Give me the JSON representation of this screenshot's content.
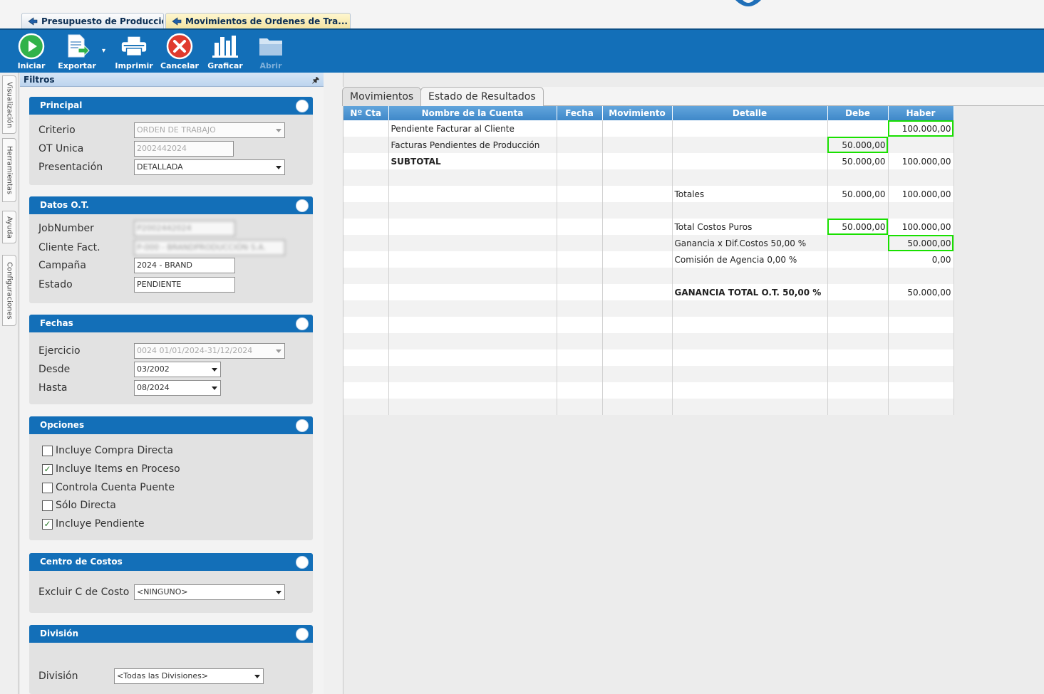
{
  "doc_tabs": [
    {
      "label": "Presupuesto de Producción",
      "active": false
    },
    {
      "label": "Movimientos de Ordenes de Tra...",
      "active": true
    }
  ],
  "toolbar": {
    "iniciar": "Iniciar",
    "exportar": "Exportar",
    "imprimir": "Imprimir",
    "cancelar": "Cancelar",
    "graficar": "Graficar",
    "abrir": "Abrir"
  },
  "side_tabs": [
    "Visualización",
    "Herramientas",
    "Ayuda",
    "Configuraciones"
  ],
  "filters": {
    "title": "Filtros",
    "pin": "🖈",
    "principal": {
      "title": "Principal",
      "criterio_label": "Criterio",
      "criterio_value": "ORDEN DE TRABAJO",
      "ot_unica_label": "OT Unica",
      "ot_unica_value": "2002442024",
      "presentacion_label": "Presentación",
      "presentacion_value": "DETALLADA"
    },
    "datos_ot": {
      "title": "Datos O.T.",
      "jobnumber_label": "JobNumber",
      "jobnumber_value": "P2002442024",
      "cliente_label": "Cliente Fact.",
      "cliente_value": "P-000 - BRANDPRODUCCIÓN S.A.",
      "campana_label": "Campaña",
      "campana_value": "2024 - BRAND",
      "estado_label": "Estado",
      "estado_value": "PENDIENTE"
    },
    "fechas": {
      "title": "Fechas",
      "ejercicio_label": "Ejercicio",
      "ejercicio_value": "0024 01/01/2024-31/12/2024",
      "desde_label": "Desde",
      "desde_value": "03/2002",
      "hasta_label": "Hasta",
      "hasta_value": "08/2024"
    },
    "opciones": {
      "title": "Opciones",
      "items": [
        {
          "label": "Incluye Compra Directa",
          "checked": false
        },
        {
          "label": "Incluye Items en Proceso",
          "checked": true
        },
        {
          "label": "Controla Cuenta Puente",
          "checked": false
        },
        {
          "label": "Sólo Directa",
          "checked": false
        },
        {
          "label": "Incluye Pendiente",
          "checked": true
        }
      ]
    },
    "centro_costos": {
      "title": "Centro de Costos",
      "excluir_label": "Excluir C de Costo",
      "excluir_value": "<NINGUNO>"
    },
    "division": {
      "title": "División",
      "division_label": "División",
      "division_value": "<Todas las Divisiones>"
    }
  },
  "result_tabs": [
    "Movimientos",
    "Estado de Resultados"
  ],
  "grid": {
    "columns": [
      "Nº Cta",
      "Nombre de la Cuenta",
      "Fecha",
      "Movimiento",
      "Detalle",
      "Debe",
      "Haber"
    ],
    "rows": [
      {
        "nombre": "Pendiente Facturar al Cliente",
        "detalle": "",
        "debe": "",
        "haber": "100.000,00",
        "hl_debe": false,
        "hl_haber": true
      },
      {
        "nombre": "Facturas Pendientes de Producción",
        "detalle": "",
        "debe": "50.000,00",
        "haber": "",
        "hl_debe": true,
        "hl_haber": false
      },
      {
        "nombre": "SUBTOTAL",
        "detalle": "",
        "debe": "50.000,00",
        "haber": "100.000,00",
        "hl_debe": false,
        "hl_haber": false
      },
      {
        "nombre": "",
        "detalle": "",
        "debe": "",
        "haber": "",
        "hl_debe": false,
        "hl_haber": false
      },
      {
        "nombre": "",
        "detalle": "Totales",
        "debe": "50.000,00",
        "haber": "100.000,00",
        "hl_debe": false,
        "hl_haber": false
      },
      {
        "nombre": "",
        "detalle": "",
        "debe": "",
        "haber": "",
        "hl_debe": false,
        "hl_haber": false
      },
      {
        "nombre": "",
        "detalle": "Total Costos Puros",
        "debe": "50.000,00",
        "haber": "100.000,00",
        "hl_debe": true,
        "hl_haber": false
      },
      {
        "nombre": "",
        "detalle": "Ganancia x Dif.Costos 50,00 %",
        "debe": "",
        "haber": "50.000,00",
        "hl_debe": false,
        "hl_haber": true
      },
      {
        "nombre": "",
        "detalle": "Comisión de Agencia 0,00 %",
        "debe": "",
        "haber": "0,00",
        "hl_debe": false,
        "hl_haber": false
      },
      {
        "nombre": "",
        "detalle": "",
        "debe": "",
        "haber": "",
        "hl_debe": false,
        "hl_haber": false
      },
      {
        "nombre": "",
        "detalle": "GANANCIA TOTAL O.T. 50,00 %",
        "debe": "",
        "haber": "50.000,00",
        "hl_debe": false,
        "hl_haber": false
      },
      {
        "nombre": "",
        "detalle": "",
        "debe": "",
        "haber": "",
        "hl_debe": false,
        "hl_haber": false
      },
      {
        "nombre": "",
        "detalle": "",
        "debe": "",
        "haber": "",
        "hl_debe": false,
        "hl_haber": false
      },
      {
        "nombre": "",
        "detalle": "",
        "debe": "",
        "haber": "",
        "hl_debe": false,
        "hl_haber": false
      },
      {
        "nombre": "",
        "detalle": "",
        "debe": "",
        "haber": "",
        "hl_debe": false,
        "hl_haber": false
      },
      {
        "nombre": "",
        "detalle": "",
        "debe": "",
        "haber": "",
        "hl_debe": false,
        "hl_haber": false
      },
      {
        "nombre": "",
        "detalle": "",
        "debe": "",
        "haber": "",
        "hl_debe": false,
        "hl_haber": false
      },
      {
        "nombre": "",
        "detalle": "",
        "debe": "",
        "haber": "",
        "hl_debe": false,
        "hl_haber": false
      }
    ]
  },
  "colors": {
    "ribbon": "#136fb8",
    "group_header": "#136fb8",
    "highlight": "#19e000",
    "grid_header": "#3f88c9"
  }
}
